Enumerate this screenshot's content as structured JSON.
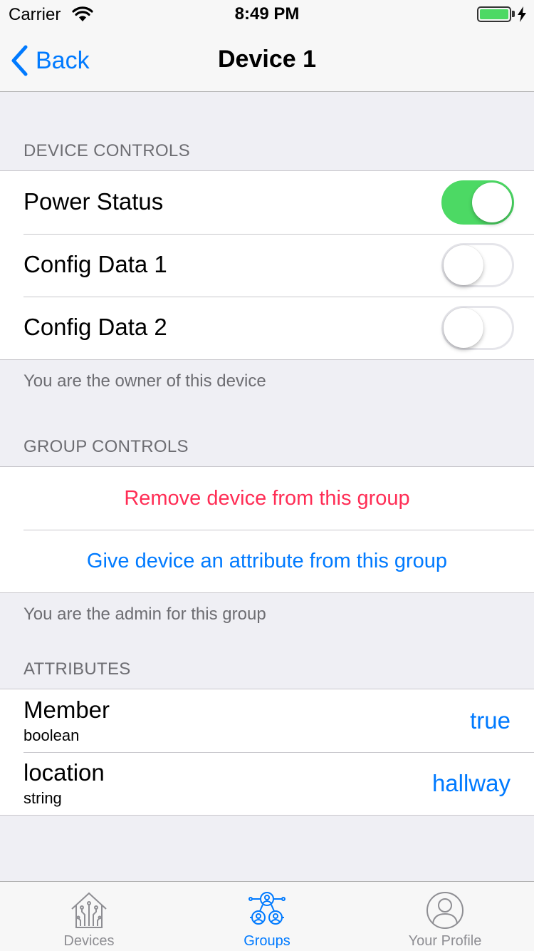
{
  "status_bar": {
    "carrier": "Carrier",
    "time": "8:49 PM"
  },
  "nav": {
    "back_label": "Back",
    "title": "Device 1"
  },
  "device_controls": {
    "header": "DEVICE CONTROLS",
    "items": [
      {
        "label": "Power Status",
        "on": true
      },
      {
        "label": "Config Data 1",
        "on": false
      },
      {
        "label": "Config Data 2",
        "on": false
      }
    ],
    "footer": "You are the owner of this device"
  },
  "group_controls": {
    "header": "GROUP CONTROLS",
    "remove_label": "Remove device from this group",
    "attribute_label": "Give device an attribute from this group",
    "footer": "You are the admin for this group"
  },
  "attributes": {
    "header": "ATTRIBUTES",
    "items": [
      {
        "name": "Member",
        "type": "boolean",
        "value": "true"
      },
      {
        "name": "location",
        "type": "string",
        "value": "hallway"
      }
    ]
  },
  "tab_bar": {
    "tabs": [
      {
        "label": "Devices",
        "icon": "house-circuit-icon",
        "active": false
      },
      {
        "label": "Groups",
        "icon": "group-people-icon",
        "active": true
      },
      {
        "label": "Your Profile",
        "icon": "profile-icon",
        "active": false
      }
    ]
  },
  "colors": {
    "accent": "#007aff",
    "toggle_on": "#4cd964",
    "destructive": "#ff2d55"
  }
}
